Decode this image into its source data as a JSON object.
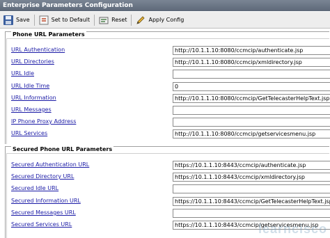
{
  "window": {
    "title": "Enterprise Parameters Configuration"
  },
  "toolbar": {
    "save": "Save",
    "set_default": "Set to Default",
    "reset": "Reset",
    "apply_config": "Apply Config"
  },
  "phone_url": {
    "title": "Phone URL Parameters",
    "rows": [
      {
        "label": "URL Authentication",
        "value": "http://10.1.1.10:8080/ccmcip/authenticate.jsp"
      },
      {
        "label": "URL Directories",
        "value": "http://10.1.1.10:8080/ccmcip/xmldirectory.jsp"
      },
      {
        "label": "URL Idle",
        "value": ""
      },
      {
        "label": "URL Idle Time",
        "value": "0"
      },
      {
        "label": "URL Information",
        "value": "http://10.1.1.10:8080/ccmcip/GetTelecasterHelpText.jsp"
      },
      {
        "label": "URL Messages",
        "value": ""
      },
      {
        "label": "IP Phone Proxy Address",
        "value": ""
      },
      {
        "label": "URL Services",
        "value": "http://10.1.1.10:8080/ccmcip/getservicesmenu.jsp"
      }
    ]
  },
  "secured_url": {
    "title": "Secured Phone URL Parameters",
    "rows": [
      {
        "label": "Secured Authentication URL",
        "value": "https://10.1.1.10:8443/ccmcip/authenticate.jsp"
      },
      {
        "label": "Secured Directory URL",
        "value": "https://10.1.1.10:8443/ccmcip/xmldirectory.jsp"
      },
      {
        "label": "Secured Idle URL",
        "value": ""
      },
      {
        "label": "Secured Information URL",
        "value": "https://10.1.1.10:8443/ccmcip/GetTelecasterHelpText.jsp"
      },
      {
        "label": "Secured Messages URL",
        "value": ""
      },
      {
        "label": "Secured Services URL",
        "value": "https://10.1.1.10:8443/ccmcip/getservicesmenu.jsp"
      }
    ]
  },
  "watermark": "learncisco"
}
